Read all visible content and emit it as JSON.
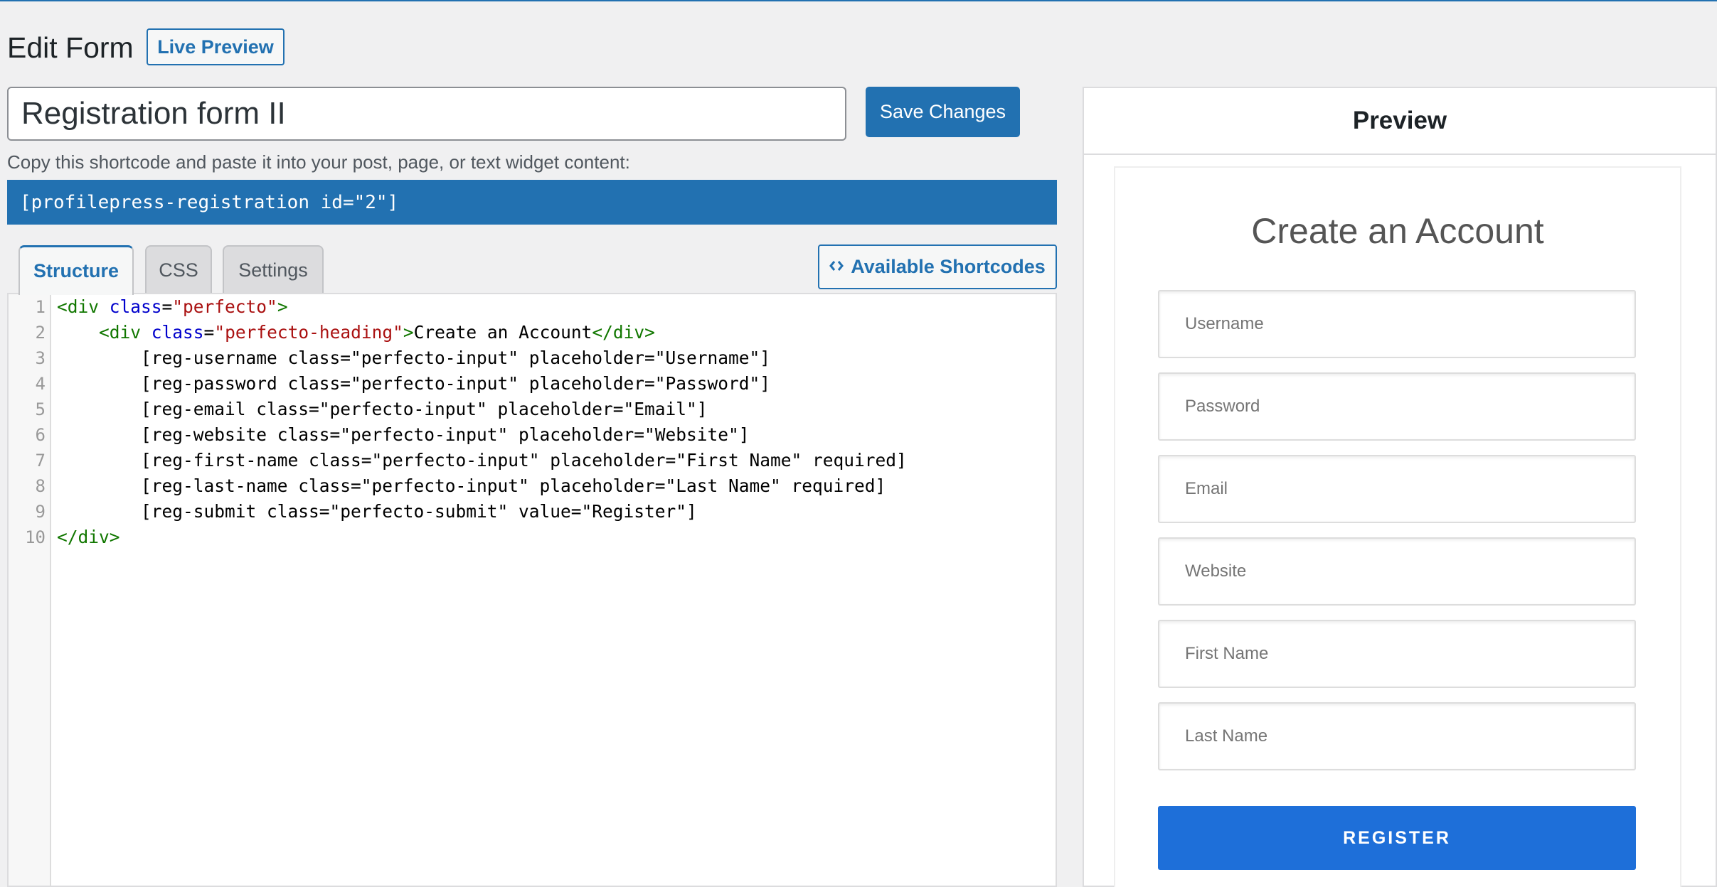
{
  "header": {
    "title": "Edit Form",
    "live_preview_label": "Live Preview"
  },
  "form_title": {
    "value": "Registration form II"
  },
  "save_label": "Save Changes",
  "shortcode": {
    "hint": "Copy this shortcode and paste it into your post, page, or text widget content:",
    "code": "[profilepress-registration id=\"2\"]"
  },
  "tabs": [
    {
      "label": "Structure",
      "active": true
    },
    {
      "label": "CSS",
      "active": false
    },
    {
      "label": "Settings",
      "active": false
    }
  ],
  "available_shortcodes_label": "Available Shortcodes",
  "editor": {
    "line_numbers": [
      "1",
      "2",
      "3",
      "4",
      "5",
      "6",
      "7",
      "8",
      "9",
      "10"
    ],
    "lines": [
      {
        "parts": [
          [
            "tg",
            "<div "
          ],
          [
            "at",
            "class"
          ],
          [
            "",
            "="
          ],
          [
            "st",
            "\"perfecto\""
          ],
          [
            "tg",
            ">"
          ]
        ]
      },
      {
        "parts": [
          [
            "",
            "    "
          ],
          [
            "tg",
            "<div "
          ],
          [
            "at",
            "class"
          ],
          [
            "",
            "="
          ],
          [
            "st",
            "\"perfecto-heading\""
          ],
          [
            "tg",
            ">"
          ],
          [
            "",
            "Create an Account"
          ],
          [
            "tg",
            "</div>"
          ]
        ]
      },
      {
        "parts": [
          [
            "",
            "        [reg-username class=\"perfecto-input\" placeholder=\"Username\"]"
          ]
        ]
      },
      {
        "parts": [
          [
            "",
            "        [reg-password class=\"perfecto-input\" placeholder=\"Password\"]"
          ]
        ]
      },
      {
        "parts": [
          [
            "",
            "        [reg-email class=\"perfecto-input\" placeholder=\"Email\"]"
          ]
        ]
      },
      {
        "parts": [
          [
            "",
            "        [reg-website class=\"perfecto-input\" placeholder=\"Website\"]"
          ]
        ]
      },
      {
        "parts": [
          [
            "",
            "        [reg-first-name class=\"perfecto-input\" placeholder=\"First Name\" required]"
          ]
        ]
      },
      {
        "parts": [
          [
            "",
            "        [reg-last-name class=\"perfecto-input\" placeholder=\"Last Name\" required]"
          ]
        ]
      },
      {
        "parts": [
          [
            "",
            "        [reg-submit class=\"perfecto-submit\" value=\"Register\"]"
          ]
        ]
      },
      {
        "parts": [
          [
            "tg",
            "</div>"
          ]
        ]
      }
    ]
  },
  "preview": {
    "title": "Preview",
    "form_heading": "Create an Account",
    "fields": [
      {
        "placeholder": "Username"
      },
      {
        "placeholder": "Password"
      },
      {
        "placeholder": "Email"
      },
      {
        "placeholder": "Website"
      },
      {
        "placeholder": "First Name"
      },
      {
        "placeholder": "Last Name"
      }
    ],
    "submit_label": "REGISTER"
  },
  "colors": {
    "accent": "#2271b1",
    "register_button": "#1e6fd9",
    "background": "#f0f0f1"
  }
}
